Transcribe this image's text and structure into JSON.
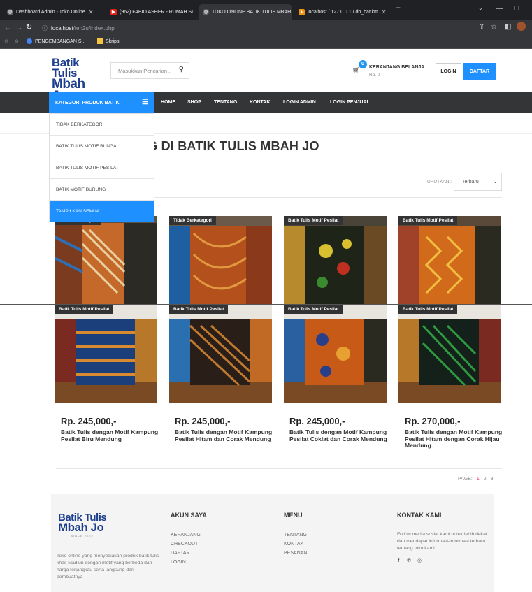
{
  "browser": {
    "tabs": [
      {
        "title": "Dashboard Admin - Toko Online",
        "icon": "globe-icon"
      },
      {
        "title": "(962) FABIO ASHER - RUMAH SI",
        "icon": "youtube-icon"
      },
      {
        "title": "TOKO ONLINE BATIK TULIS MBAH",
        "icon": "globe-icon"
      },
      {
        "title": "localhost / 127.0.0.1 / db_batikm",
        "icon": "phpmyadmin-icon"
      }
    ],
    "url_host": "localhost",
    "url_path": "/fen2u/index.php",
    "bookmarks": [
      {
        "label": "PENGEMBANGAN S...",
        "icon": "bookmark-globe-icon"
      },
      {
        "label": "Skripsi",
        "icon": "folder-icon"
      }
    ]
  },
  "header": {
    "logo_line1": "Batik Tulis",
    "logo_line2": "Mbah Jo",
    "logo_sub": "SINCE 2022",
    "search_placeholder": "Masukkan Pencarian ..",
    "cart_count": "0",
    "cart_title": "KERANJANG BELANJA :",
    "cart_amount": "Rp. 0 ,-",
    "login_label": "LOGIN",
    "register_label": "DAFTAR"
  },
  "nav": {
    "category_button": "KATEGORI PRODUK BATIK",
    "links": [
      "HOME",
      "SHOP",
      "TENTANG",
      "KONTAK",
      "LOGIN ADMIN",
      "LOGIN PENJUAL"
    ]
  },
  "category_menu": [
    "TIDAK BERKATEGORI",
    "BATIK TULIS MOTIF BUNGA",
    "BATIK TULIS MOTIF PESILAT",
    "BATIK MOTIF BURUNG",
    "TAMPILKAN SEMUA"
  ],
  "main": {
    "heading": "NG DI BATIK TULIS MBAH JO",
    "sort_label": "URUTKAN :",
    "sort_value": "Terbaru"
  },
  "products_top": [
    {
      "tag": "Tidak Berkategori"
    },
    {
      "tag": "Tidak Berkategori"
    },
    {
      "tag": "Batik Tulis Motif Pesilat"
    },
    {
      "tag": "Batik Tulis Motif Pesilat"
    }
  ],
  "products": [
    {
      "tag": "Batik Tulis Motif Pesilat",
      "price": "Rp. 245,000,-",
      "name": "Batik Tulis dengan Motif Kampung Pesilat Biru Mendung"
    },
    {
      "tag": "Batik Tulis Motif Pesilat",
      "price": "Rp. 245,000,-",
      "name": "Batik Tulis dengan Motif Kampung Pesilat Hitam dan Corak Mendung"
    },
    {
      "tag": "Batik Tulis Motif Pesilat",
      "price": "Rp. 245,000,-",
      "name": "Batik Tulis dengan Motif Kampung Pesilat Coklat dan Corak Mendung"
    },
    {
      "tag": "Batik Tulis Motif Pesilat",
      "price": "Rp. 270,000,-",
      "name": "Batik Tulis dengan Motif Kampung Pesilat Hitam dengan Corak Hijau Mendung"
    }
  ],
  "pagination": {
    "label": "PAGE:",
    "pages": [
      "1",
      "2",
      "3"
    ],
    "active": "1"
  },
  "footer": {
    "about_text": "Toko online yang menyediakan produk batik tulis khas Madiun dengan motif yang berbeda dan harga terjangkau serta langsung dari pembuatnya",
    "account_title": "AKUN SAYA",
    "account_links": [
      "KERANJANG",
      "CHECKOUT",
      "DAFTAR",
      "LOGIN"
    ],
    "menu_title": "MENU",
    "menu_links": [
      "TENTANG",
      "KONTAK",
      "PESANAN"
    ],
    "contact_title": "KONTAK KAMI",
    "contact_text": "Follow media sosial kami untuk lebih dekat dan mendapat informasi-informasi terbaru tentang toko kami.",
    "social_icons": [
      "facebook-icon",
      "whatsapp-icon",
      "instagram-icon"
    ]
  }
}
